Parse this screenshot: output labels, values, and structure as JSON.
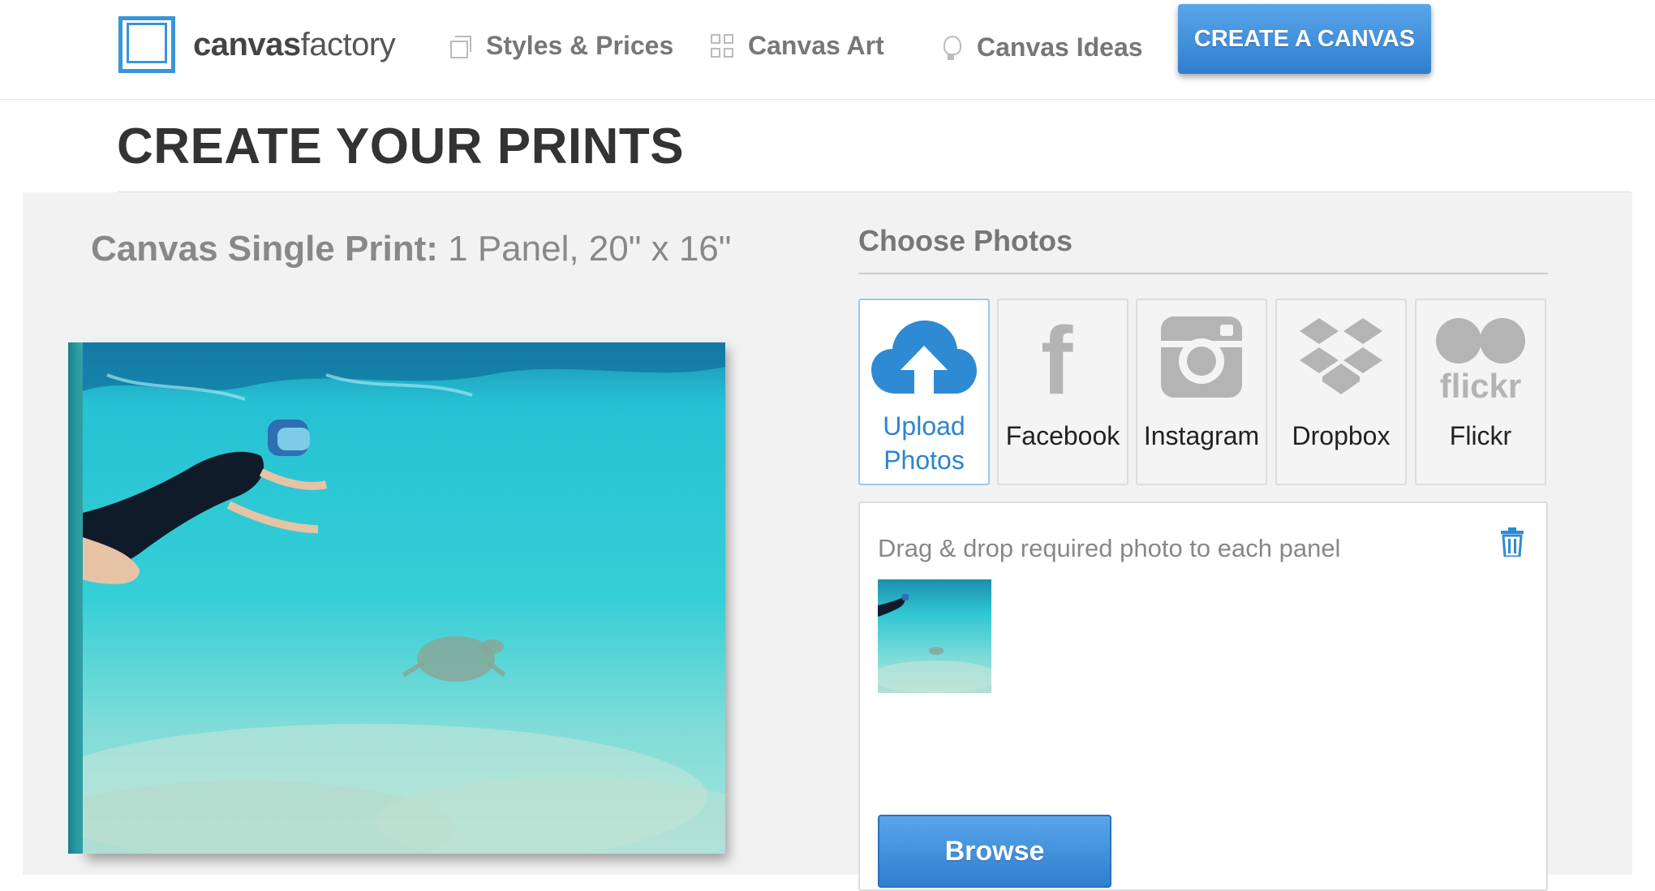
{
  "header": {
    "logo": {
      "brand_bold": "canvas",
      "brand_light": "factory"
    },
    "nav": [
      {
        "label": "Styles & Prices",
        "icon": "squares-icon"
      },
      {
        "label": "Canvas Art",
        "icon": "grid-icon"
      },
      {
        "label": "Canvas Ideas",
        "icon": "lightbulb-icon"
      }
    ],
    "cta_label": "CREATE A CANVAS"
  },
  "page": {
    "title": "CREATE YOUR PRINTS",
    "product_name": "Canvas Single Print:",
    "product_spec": "1 Panel, 20\" x 16\""
  },
  "choose": {
    "title": "Choose Photos",
    "sources": [
      {
        "label_line1": "Upload",
        "label_line2": "Photos",
        "icon": "cloud-upload-icon",
        "active": true
      },
      {
        "label_line1": "Facebook",
        "label_line2": "",
        "icon": "facebook-icon",
        "active": false
      },
      {
        "label_line1": "Instagram",
        "label_line2": "",
        "icon": "instagram-icon",
        "active": false
      },
      {
        "label_line1": "Dropbox",
        "label_line2": "",
        "icon": "dropbox-icon",
        "active": false
      },
      {
        "label_line1": "Flickr",
        "label_line2": "",
        "icon": "flickr-icon",
        "active": false
      }
    ],
    "flickr_logo_text": "flickr",
    "facebook_logo_text": "f"
  },
  "dropzone": {
    "instruction": "Drag & drop required photo to each panel",
    "browse_label": "Browse"
  },
  "colors": {
    "accent": "#3a95d8",
    "button_top": "#5aa5ea",
    "button_bottom": "#2e7fd0",
    "panel_bg": "#f2f2f2",
    "water": "#2cc6d2"
  }
}
